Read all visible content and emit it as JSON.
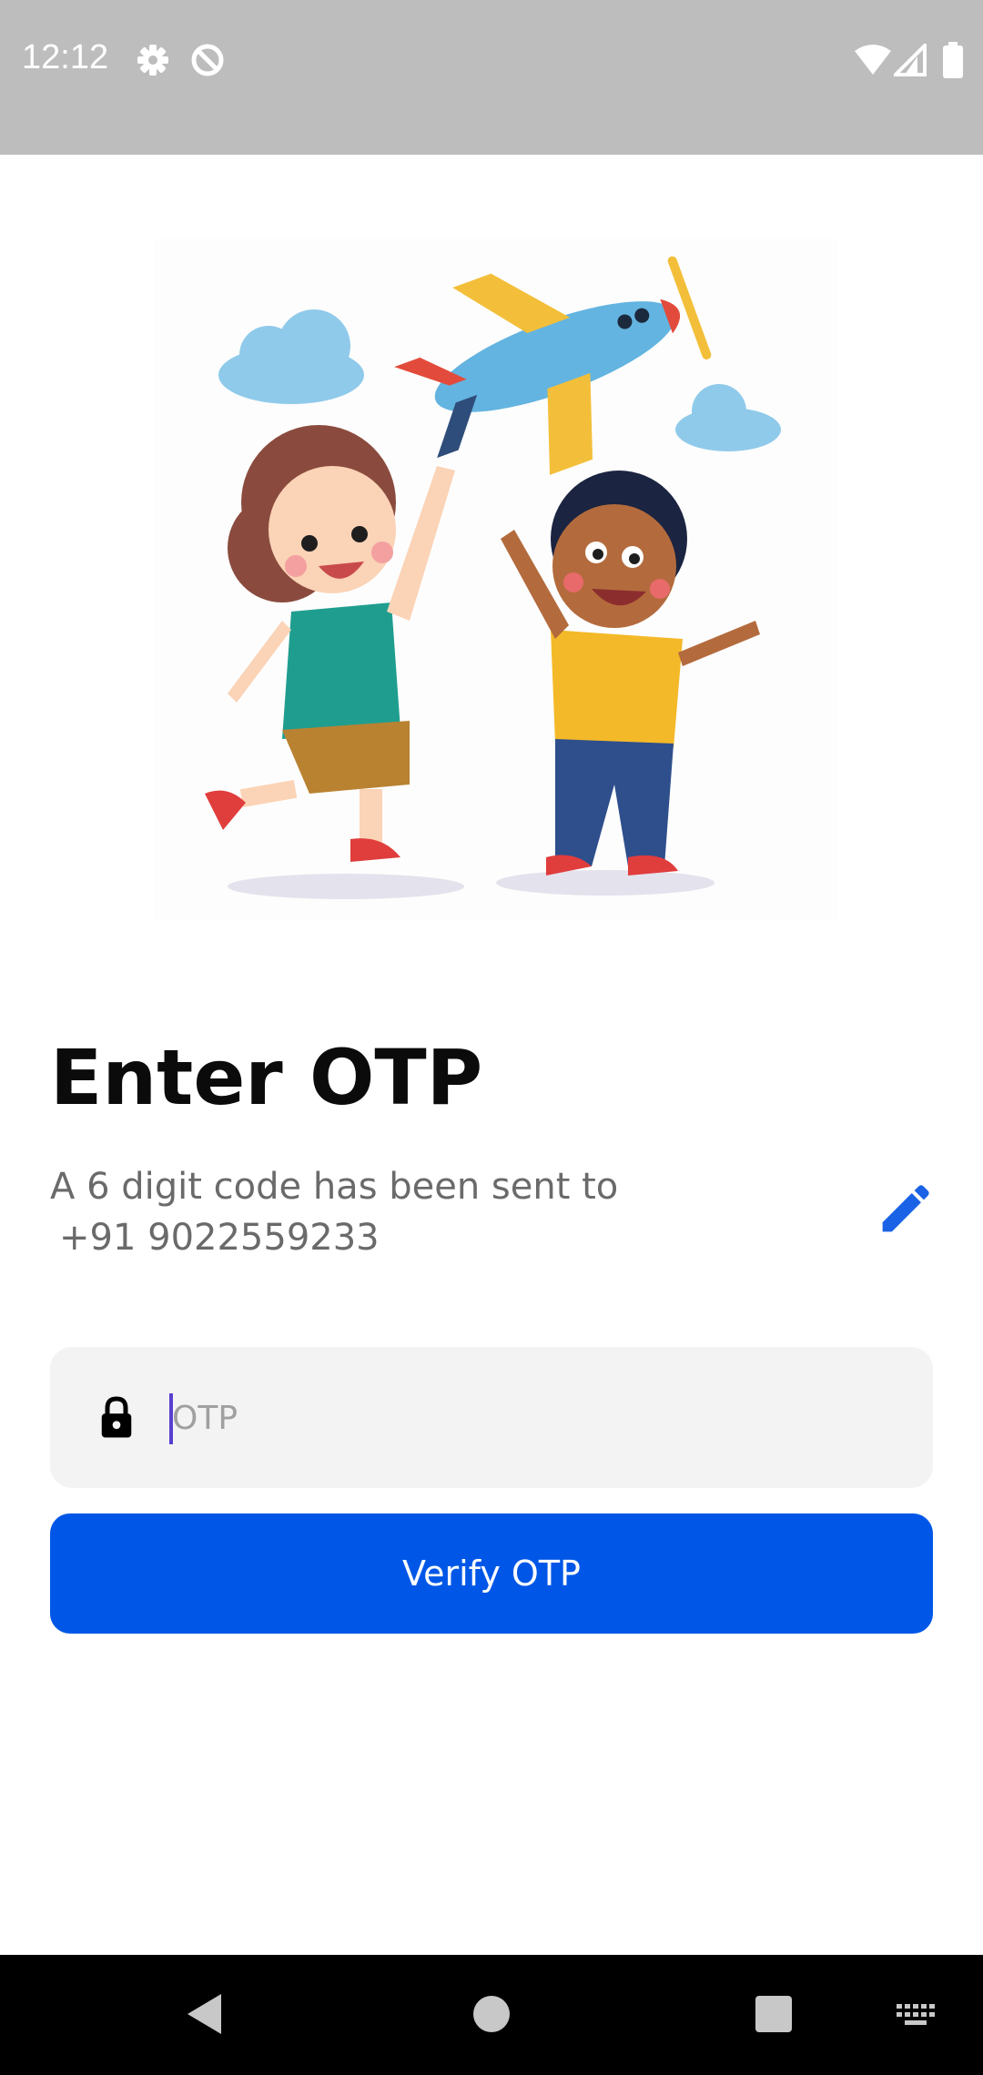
{
  "status_bar": {
    "time": "12:12",
    "icons": [
      "gear-icon",
      "data-saver-icon",
      "wifi-icon",
      "signal-icon",
      "battery-icon"
    ]
  },
  "illustration": {
    "description_icon": "kids-with-airplane-illustration"
  },
  "page": {
    "title": "Enter OTP",
    "subtitle_line1": "A 6 digit code has been sent to",
    "phone": "+91 9022559233"
  },
  "otp": {
    "placeholder": "OTP",
    "value": ""
  },
  "actions": {
    "verify_label": "Verify OTP"
  },
  "colors": {
    "primary": "#0057e7",
    "edit_icon": "#1a63e6",
    "status_bar": "#bdbdbd",
    "field_bg": "#f3f3f3"
  },
  "nav_bar": {
    "icons": [
      "back-icon",
      "home-icon",
      "recents-icon",
      "keyboard-icon"
    ]
  }
}
